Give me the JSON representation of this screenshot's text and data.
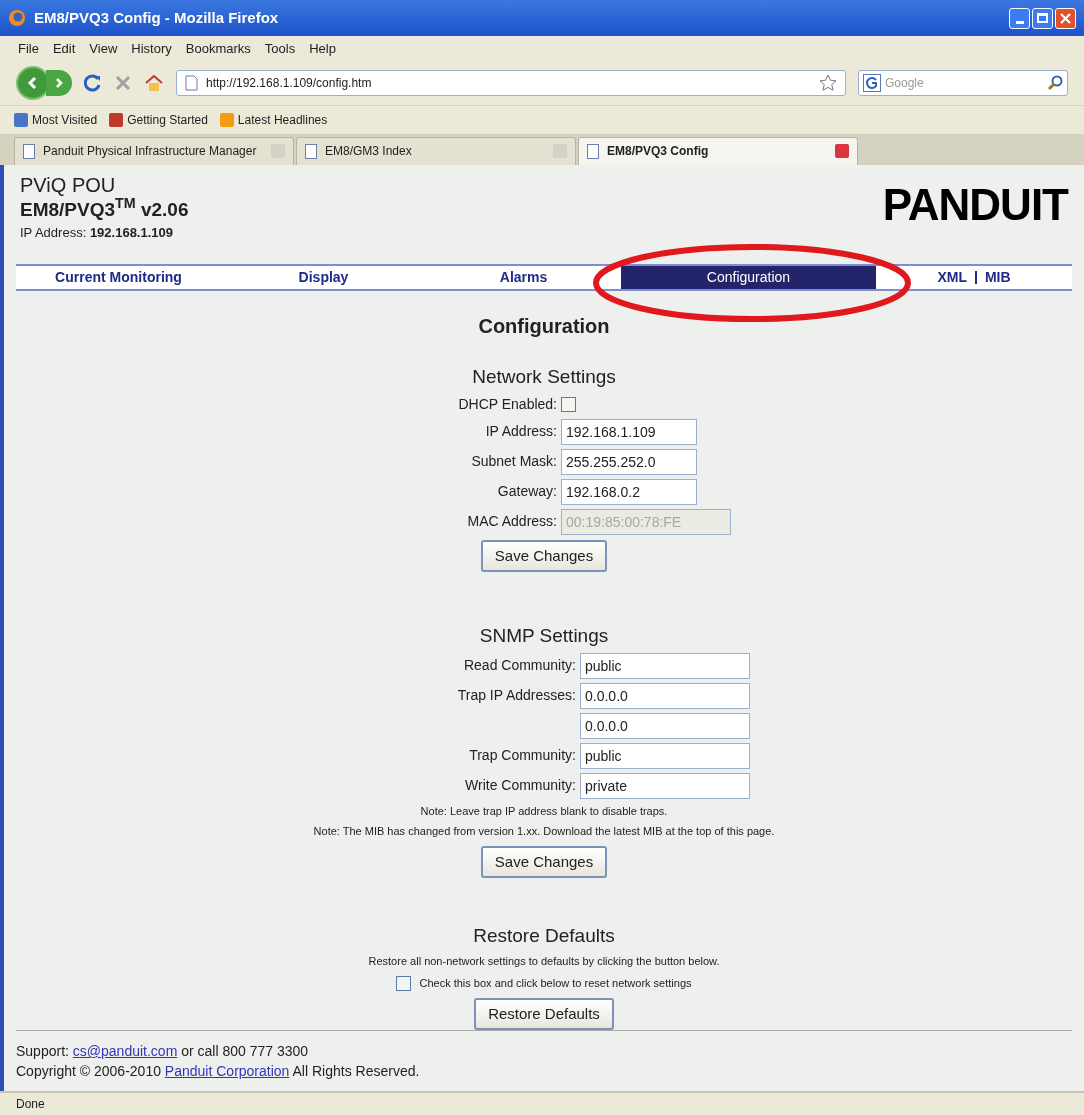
{
  "window": {
    "title": "EM8/PVQ3 Config - Mozilla Firefox"
  },
  "menu": [
    "File",
    "Edit",
    "View",
    "History",
    "Bookmarks",
    "Tools",
    "Help"
  ],
  "address": {
    "value": "http://192.168.1.109/config.htm"
  },
  "search": {
    "placeholder": "Google"
  },
  "bookmarks": [
    "Most Visited",
    "Getting Started",
    "Latest Headlines"
  ],
  "tabs": [
    {
      "label": "Panduit Physical Infrastructure Manager",
      "selected": false
    },
    {
      "label": "EM8/GM3 Index",
      "selected": false
    },
    {
      "label": "EM8/PVQ3 Config",
      "selected": true
    }
  ],
  "header": {
    "product": "PViQ POU",
    "model": "EM8/PVQ3$^{TM}$ v2.06",
    "ip_label": "IP Address:",
    "ip_value": "192.168.1.109",
    "logo": "PANDUIT"
  },
  "nav": [
    {
      "label": "Current Monitoring",
      "selected": false
    },
    {
      "label": "Display",
      "selected": false
    },
    {
      "label": "Alarms",
      "selected": false
    },
    {
      "label": "Configuration",
      "selected": true
    }
  ],
  "nav_links": [
    "XML",
    "MIB"
  ],
  "page_title": "Configuration",
  "network": {
    "title": "Network Settings",
    "rows": [
      {
        "kind": "checkbox",
        "label": "DHCP Enabled:",
        "checked": false
      },
      {
        "kind": "field",
        "label": "IP Address:",
        "value": "192.168.1.109",
        "disabled": false
      },
      {
        "kind": "field",
        "label": "Subnet Mask:",
        "value": "255.255.252.0",
        "disabled": false
      },
      {
        "kind": "field",
        "label": "Gateway:",
        "value": "192.168.0.2",
        "disabled": false
      },
      {
        "kind": "field",
        "label": "MAC Address:",
        "value": "00:19:85:00:78:FE",
        "disabled": true
      }
    ],
    "button": "Save Changes"
  },
  "snmp": {
    "title": "SNMP Settings",
    "rows": [
      {
        "label": "Read Community:",
        "value": "public"
      },
      {
        "label": "Trap IP Addresses:",
        "value": "0.0.0.0"
      },
      {
        "value": "0.0.0.0"
      },
      {
        "label": "Trap Community:",
        "value": "public"
      },
      {
        "label": "Write Community:",
        "value": "private"
      }
    ],
    "notes": [
      "Note: Leave trap IP address blank to disable traps.",
      "Note: The MIB has changed from version 1.xx. Download the latest MIB at the top of this page."
    ],
    "button": "Save Changes"
  },
  "restore": {
    "title": "Restore Defaults",
    "text": "Restore all non-network settings to defaults by clicking the button below.",
    "checkbox": {
      "label": "Check this box and click below to reset network settings",
      "checked": false
    },
    "button": "Restore Defaults"
  },
  "footer": {
    "support": {
      "prefix": "Support:",
      "email": "cs@panduit.com",
      "suffix": "or call 800 777 3300"
    },
    "copyright": {
      "prefix": "Copyright © 2006-2010",
      "link": "Panduit Corporation",
      "suffix": "All Rights Reserved."
    }
  },
  "status_bar": "Done"
}
